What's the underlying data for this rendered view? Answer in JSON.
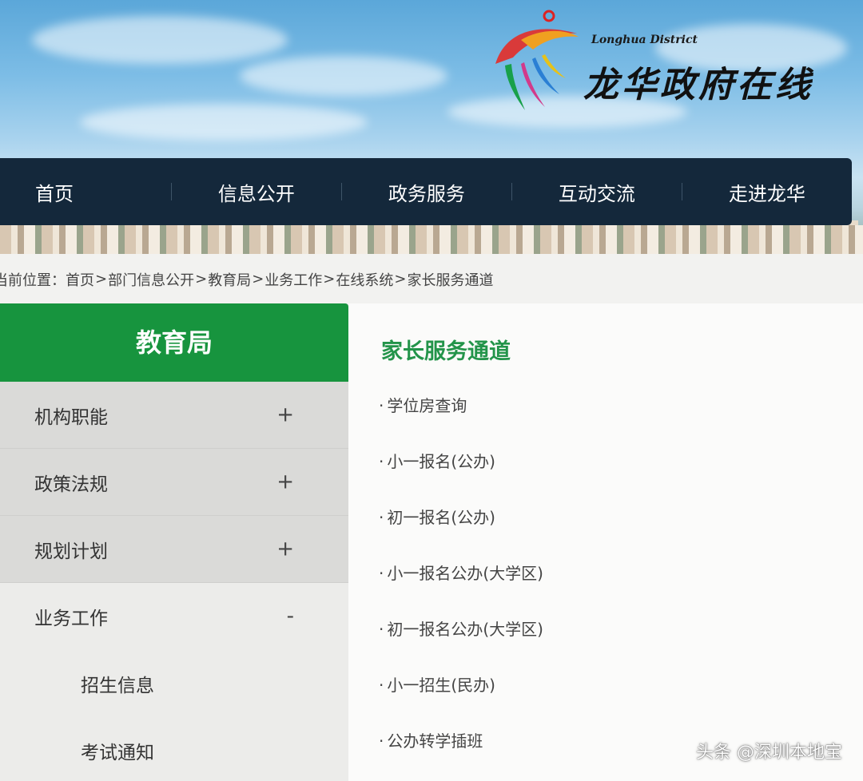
{
  "site": {
    "logo_en": "Longhua District",
    "logo_cn": "龙华政府在线"
  },
  "nav": [
    "首页",
    "信息公开",
    "政务服务",
    "互动交流",
    "走进龙华"
  ],
  "breadcrumb": {
    "prefix": "当前位置：",
    "items": [
      "首页",
      "部门信息公开",
      "教育局",
      "业务工作",
      "在线系统",
      "家长服务通道"
    ],
    "separator": ">"
  },
  "sidebar": {
    "title": "教育局",
    "items": [
      {
        "label": "机构职能",
        "toggle": "+"
      },
      {
        "label": "政策法规",
        "toggle": "+"
      },
      {
        "label": "规划计划",
        "toggle": "+"
      },
      {
        "label": "业务工作",
        "toggle": "-"
      }
    ],
    "subitems": [
      "招生信息",
      "考试通知"
    ]
  },
  "main": {
    "title": "家长服务通道",
    "bullet": "·",
    "links": [
      "学位房查询",
      "小一报名(公办)",
      "初一报名(公办)",
      "小一报名公办(大学区)",
      "初一报名公办(大学区)",
      "小一招生(民办)",
      "公办转学插班"
    ]
  },
  "watermark": "头条 @深圳本地宝",
  "colors": {
    "nav_bg": "#14283b",
    "sidebar_head": "#17943e",
    "title_green": "#23944a"
  }
}
